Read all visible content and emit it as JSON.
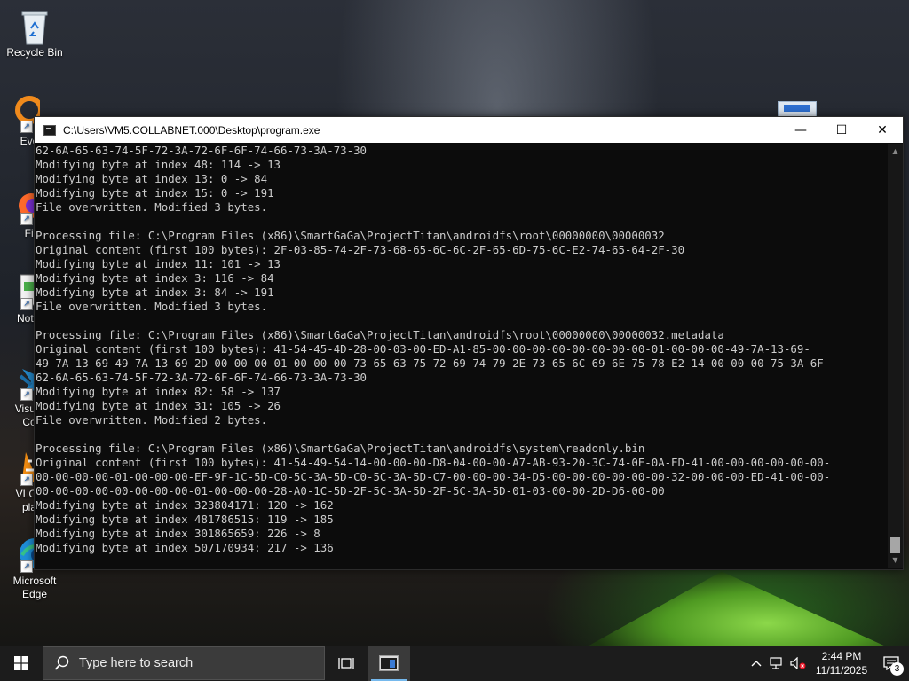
{
  "desktop": {
    "icons": [
      {
        "label": "Recycle Bin"
      },
      {
        "label": "Every"
      },
      {
        "label": "Fire"
      },
      {
        "label": "Notep"
      },
      {
        "label": "Visual\nCo"
      },
      {
        "label": "VLC r\npla"
      },
      {
        "label": "Microsoft\nEdge"
      }
    ]
  },
  "window": {
    "title": "C:\\Users\\VM5.COLLABNET.000\\Desktop\\program.exe",
    "minimize_symbol": "—",
    "maximize_symbol": "☐",
    "close_symbol": "✕",
    "console_lines": [
      "62-6A-65-63-74-5F-72-3A-72-6F-6F-74-66-73-3A-73-30",
      "Modifying byte at index 48: 114 -> 13",
      "Modifying byte at index 13: 0 -> 84",
      "Modifying byte at index 15: 0 -> 191",
      "File overwritten. Modified 3 bytes.",
      "",
      "Processing file: C:\\Program Files (x86)\\SmartGaGa\\ProjectTitan\\androidfs\\root\\00000000\\00000032",
      "Original content (first 100 bytes): 2F-03-85-74-2F-73-68-65-6C-6C-2F-65-6D-75-6C-E2-74-65-64-2F-30",
      "Modifying byte at index 11: 101 -> 13",
      "Modifying byte at index 3: 116 -> 84",
      "Modifying byte at index 3: 84 -> 191",
      "File overwritten. Modified 3 bytes.",
      "",
      "Processing file: C:\\Program Files (x86)\\SmartGaGa\\ProjectTitan\\androidfs\\root\\00000000\\00000032.metadata",
      "Original content (first 100 bytes): 41-54-45-4D-28-00-03-00-ED-A1-85-00-00-00-00-00-00-00-00-01-00-00-00-49-7A-13-69-",
      "49-7A-13-69-49-7A-13-69-2D-00-00-00-01-00-00-00-73-65-63-75-72-69-74-79-2E-73-65-6C-69-6E-75-78-E2-14-00-00-00-75-3A-6F-",
      "62-6A-65-63-74-5F-72-3A-72-6F-6F-74-66-73-3A-73-30",
      "Modifying byte at index 82: 58 -> 137",
      "Modifying byte at index 31: 105 -> 26",
      "File overwritten. Modified 2 bytes.",
      "",
      "Processing file: C:\\Program Files (x86)\\SmartGaGa\\ProjectTitan\\androidfs\\system\\readonly.bin",
      "Original content (first 100 bytes): 41-54-49-54-14-00-00-00-D8-04-00-00-A7-AB-93-20-3C-74-0E-0A-ED-41-00-00-00-00-00-00-",
      "00-00-00-00-01-00-00-00-EF-9F-1C-5D-C0-5C-3A-5D-C0-5C-3A-5D-C7-00-00-00-34-D5-00-00-00-00-00-00-32-00-00-00-ED-41-00-00-",
      "00-00-00-00-00-00-00-00-01-00-00-00-28-A0-1C-5D-2F-5C-3A-5D-2F-5C-3A-5D-01-03-00-00-2D-D6-00-00",
      "Modifying byte at index 323804171: 120 -> 162",
      "Modifying byte at index 481786515: 119 -> 185",
      "Modifying byte at index 301865659: 226 -> 8",
      "Modifying byte at index 507170934: 217 -> 136"
    ]
  },
  "taskbar": {
    "search_placeholder": "Type here to search",
    "time": "2:44 PM",
    "date": "11/11/2025",
    "notification_count": "3"
  },
  "colors": {
    "console_bg": "#0c0c0c",
    "console_text": "#cccccc",
    "taskbar_bg": "#1c1c1c",
    "accent": "#76b9ed"
  }
}
